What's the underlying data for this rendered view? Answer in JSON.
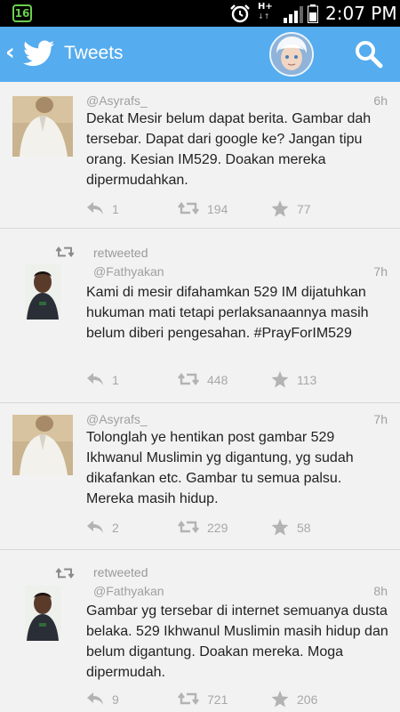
{
  "status_bar": {
    "notification_count": "16",
    "network": "H+",
    "time": "2:07 PM"
  },
  "header": {
    "back_glyph": "‹",
    "title": "Tweets"
  },
  "colors": {
    "header_blue": "#55acee",
    "muted": "#a0a0a0"
  },
  "tweets": [
    {
      "retweeted": false,
      "handle": "@Asyrafs_",
      "time": "6h",
      "text": "Dekat Mesir belum dapat berita. Gambar dah tersebar. Dapat dari google ke? Jangan tipu orang. Kesian IM529. Doakan mereka dipermudahkan.",
      "replies": "1",
      "retweets": "194",
      "favorites": "77"
    },
    {
      "retweeted": true,
      "retweet_label": "retweeted",
      "handle": "@Fathyakan",
      "time": "7h",
      "text": "Kami di mesir difahamkan 529 IM dijatuhkan hukuman mati tetapi perlaksanaannya masih belum diberi pengesahan. #PrayForIM529",
      "replies": "1",
      "retweets": "448",
      "favorites": "113"
    },
    {
      "retweeted": false,
      "handle": "@Asyrafs_",
      "time": "7h",
      "text": "Tolonglah ye hentikan post gambar 529 Ikhwanul Muslimin yg digantung, yg sudah dikafankan etc. Gambar tu semua palsu. Mereka masih hidup.",
      "replies": "2",
      "retweets": "229",
      "favorites": "58"
    },
    {
      "retweeted": true,
      "retweet_label": "retweeted",
      "handle": "@Fathyakan",
      "time": "8h",
      "text": "Gambar yg tersebar di internet semuanya dusta belaka. 529 Ikhwanul Muslimin masih hidup dan belum digantung. Doakan mereka. Moga dipermudah.",
      "replies": "9",
      "retweets": "721",
      "favorites": "206"
    }
  ]
}
